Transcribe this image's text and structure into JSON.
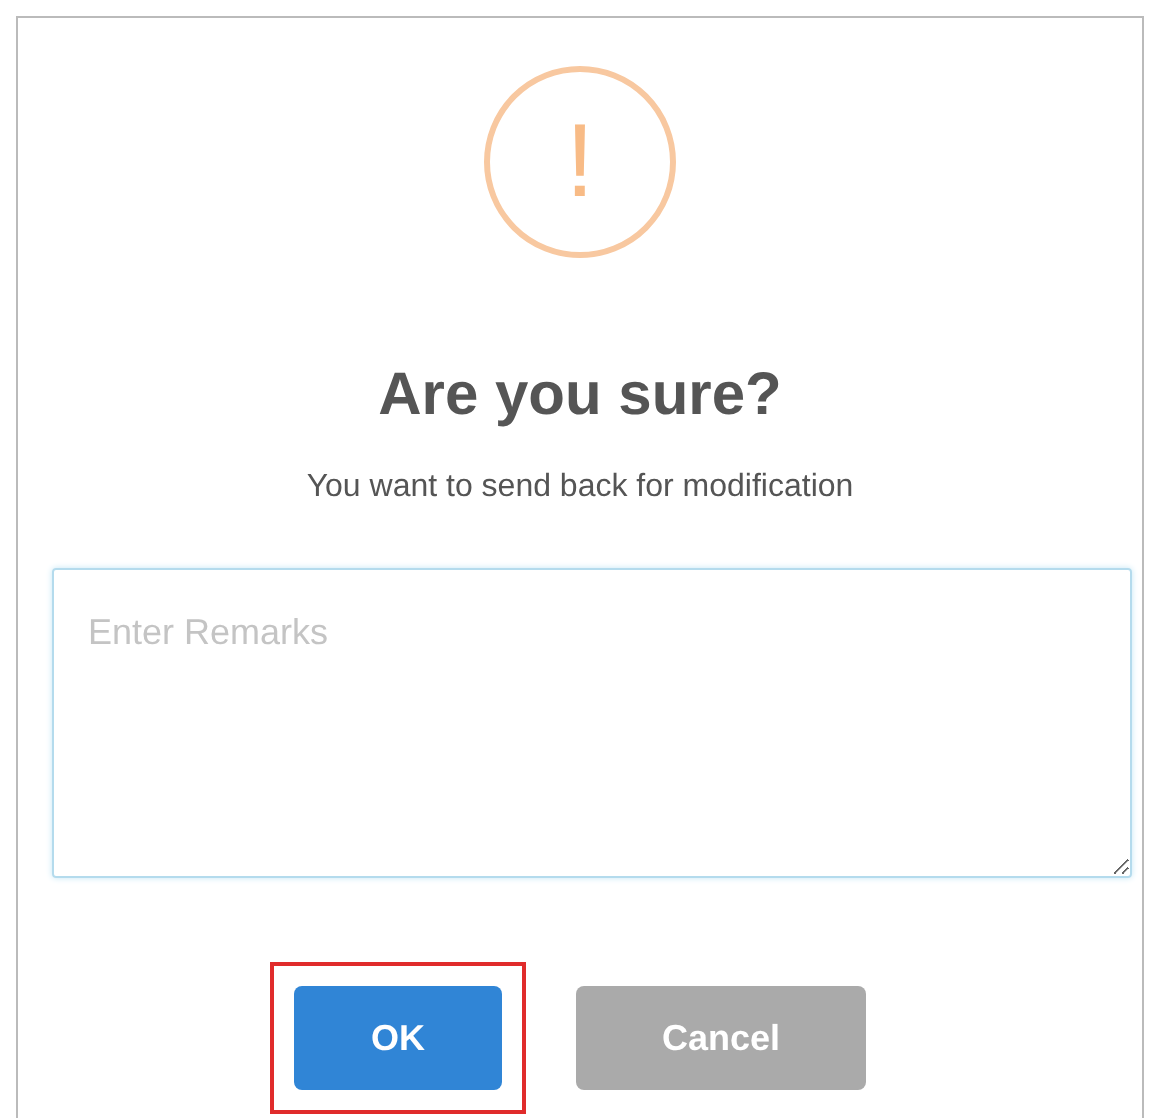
{
  "dialog": {
    "icon": "!",
    "title": "Are you sure?",
    "message": "You want to send back for modification",
    "remarks": {
      "placeholder": "Enter Remarks",
      "focused": true
    },
    "buttons": [
      {
        "label": "OK",
        "kind": "confirm",
        "highlighted": true
      },
      {
        "label": "Cancel",
        "kind": "cancel",
        "highlighted": false
      }
    ]
  }
}
